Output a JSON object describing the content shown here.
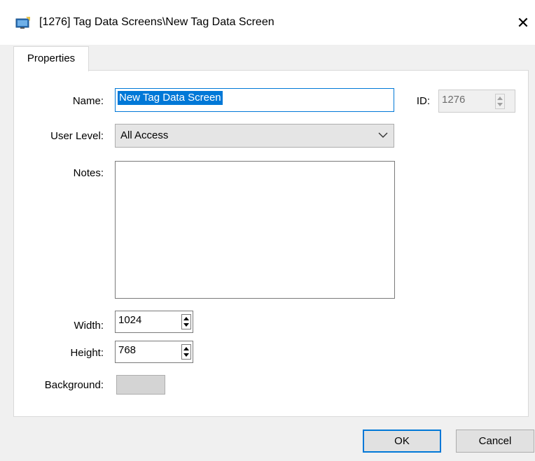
{
  "window": {
    "title": "[1276] Tag Data Screens\\New Tag Data Screen",
    "close_glyph": "✕"
  },
  "tabs": [
    {
      "label": "Properties",
      "active": true
    }
  ],
  "form": {
    "name_label": "Name:",
    "name_value": "New Tag Data Screen",
    "id_label": "ID:",
    "id_value": "1276",
    "user_level_label": "User Level:",
    "user_level_value": "All Access",
    "notes_label": "Notes:",
    "notes_value": "",
    "width_label": "Width:",
    "width_value": "1024",
    "height_label": "Height:",
    "height_value": "768",
    "background_label": "Background:",
    "background_color": "#d4d4d4"
  },
  "buttons": {
    "ok": "OK",
    "cancel": "Cancel"
  },
  "colors": {
    "accent": "#0078d7",
    "panel": "#ffffff",
    "chrome": "#f0f0f0"
  }
}
